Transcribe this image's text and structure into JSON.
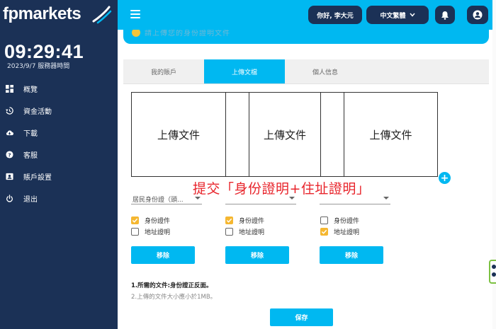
{
  "brand": {
    "name": "fpmarkets"
  },
  "clock": {
    "time": "09:29:41",
    "server_time": "2023/9/7 服務器時間"
  },
  "sidebar": {
    "items": [
      {
        "label": "概覽",
        "icon": "dashboard-icon"
      },
      {
        "label": "資金活動",
        "icon": "history-icon"
      },
      {
        "label": "下載",
        "icon": "cloud-download-icon"
      },
      {
        "label": "客服",
        "icon": "help-icon"
      },
      {
        "label": "賬戶設置",
        "icon": "account-card-icon"
      },
      {
        "label": "退出",
        "icon": "power-icon"
      }
    ]
  },
  "header": {
    "user_greeting": "你好, 李大元",
    "language": "中文繁體"
  },
  "notice": {
    "text": "請上傳您的身份證明文件"
  },
  "tabs": [
    {
      "label": "我的賬戶",
      "active": false
    },
    {
      "label": "上傳文檔",
      "active": true
    },
    {
      "label": "個人信息",
      "active": false
    }
  ],
  "uploads": [
    {
      "label": "上傳文件"
    },
    {
      "label": "上傳文件"
    },
    {
      "label": "上傳文件"
    }
  ],
  "annotation": "提交「身份證明+住址證明」",
  "doc_columns": [
    {
      "select_value": "居民身份證（頭...",
      "id_checked": true,
      "address_checked": false
    },
    {
      "select_value": "",
      "id_checked": true,
      "address_checked": false
    },
    {
      "select_value": "",
      "id_checked": false,
      "address_checked": true
    }
  ],
  "labels": {
    "id_proof": "身份證件",
    "address_proof": "地址證明",
    "remove": "移除",
    "save": "保存"
  },
  "notes": {
    "line1": "1.所需的文件:身份證正反面。",
    "line2": "2.上傳的文件大小應小於1MB。"
  },
  "colors": {
    "accent": "#00b8f1",
    "sidebar": "#1b3156",
    "check": "#f5b731",
    "annotation": "#e8242b"
  }
}
